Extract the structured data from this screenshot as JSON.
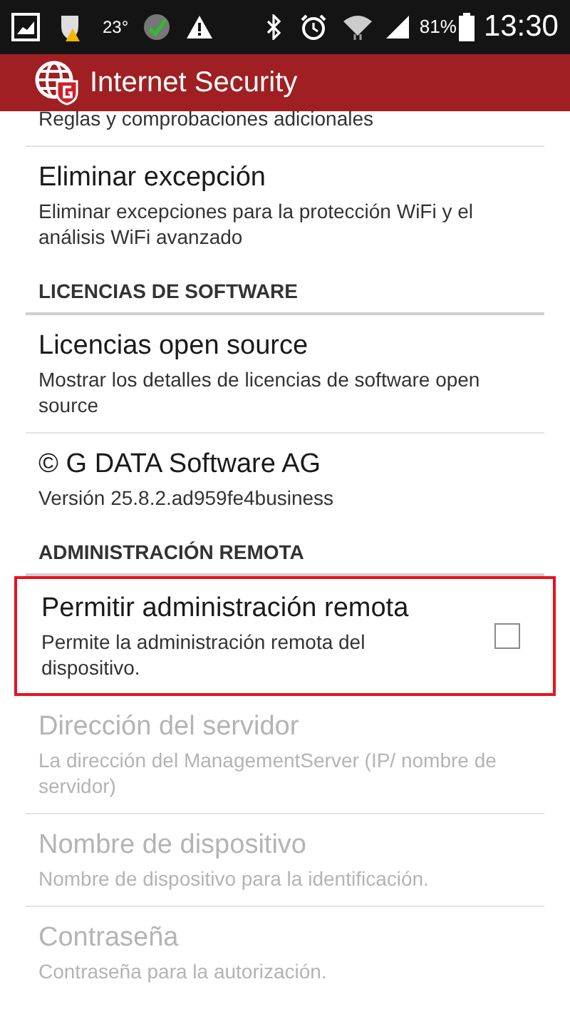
{
  "status_bar": {
    "temperature": "23°",
    "battery": "81%",
    "time": "13:30"
  },
  "app_bar": {
    "title": "Internet Security"
  },
  "groups": [
    {
      "items": [
        {
          "kind": "preference",
          "summary": "Reglas y comprobaciones adicionales",
          "disabled": false
        },
        {
          "kind": "preference",
          "title": "Eliminar excepción",
          "summary": "Eliminar excepciones para la protección WiFi y el análisis WiFi avanzado",
          "disabled": false
        }
      ]
    },
    {
      "header": "LICENCIAS DE SOFTWARE",
      "items": [
        {
          "kind": "preference",
          "title": "Licencias open source",
          "summary": "Mostrar los detalles de licencias de software open source",
          "disabled": false
        },
        {
          "kind": "preference",
          "title": "© G DATA Software AG",
          "summary": "Versión 25.8.2.ad959fe4business",
          "disabled": false
        }
      ]
    },
    {
      "header": "ADMINISTRACIÓN REMOTA",
      "items": [
        {
          "kind": "checkbox",
          "title": "Permitir administración remota",
          "summary": "Permite la administración remota del dispositivo.",
          "checked": false,
          "highlighted": true,
          "disabled": false
        },
        {
          "kind": "preference",
          "title": "Dirección del servidor",
          "summary": "La dirección del ManagementServer (IP/ nombre de servidor)",
          "disabled": true
        },
        {
          "kind": "preference",
          "title": "Nombre de dispositivo",
          "summary": "Nombre de dispositivo para la identificación.",
          "disabled": true
        },
        {
          "kind": "preference",
          "title": "Contraseña",
          "summary": "Contraseña para la autorización.",
          "disabled": true
        }
      ]
    }
  ]
}
